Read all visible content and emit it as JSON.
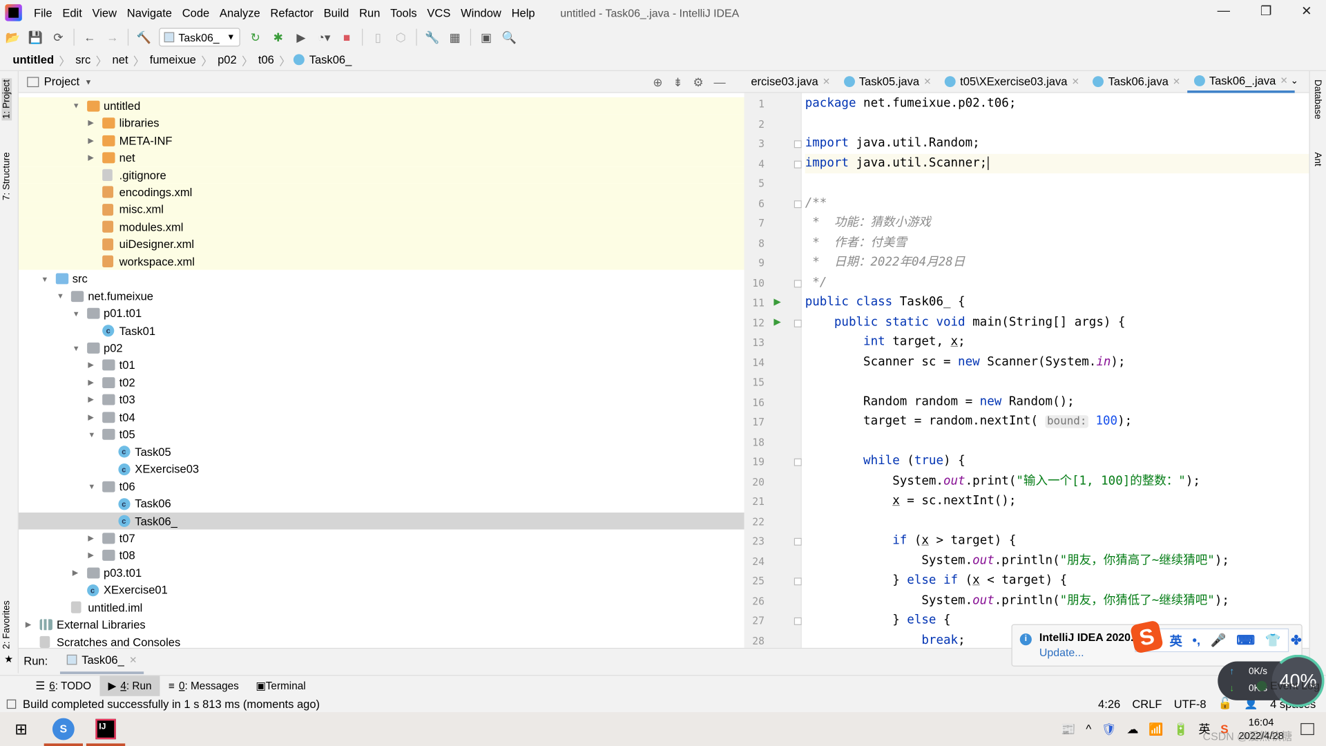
{
  "window": {
    "title": "untitled - Task06_.java - IntelliJ IDEA",
    "controls": [
      "—",
      "❐",
      "✕"
    ]
  },
  "menu": [
    "File",
    "Edit",
    "View",
    "Navigate",
    "Code",
    "Analyze",
    "Refactor",
    "Build",
    "Run",
    "Tools",
    "VCS",
    "Window",
    "Help"
  ],
  "toolbar": {
    "run_config": "Task06_"
  },
  "breadcrumb": [
    "untitled",
    "src",
    "net",
    "fumeixue",
    "p02",
    "t06",
    "Task06_"
  ],
  "left_tools": [
    "1: Project",
    "7: Structure",
    "2: Favorites"
  ],
  "right_tools": [
    "Database",
    "Ant"
  ],
  "project": {
    "title": "Project",
    "tree": [
      {
        "d": 3,
        "e": "open",
        "i": "folder orange",
        "l": "untitled",
        "x": 1
      },
      {
        "d": 4,
        "e": "closed",
        "i": "folder orange",
        "l": "libraries",
        "x": 1
      },
      {
        "d": 4,
        "e": "closed",
        "i": "folder orange",
        "l": "META-INF",
        "x": 1
      },
      {
        "d": 4,
        "e": "closed",
        "i": "folder orange",
        "l": "net",
        "x": 1
      },
      {
        "d": 4,
        "e": "",
        "i": "file",
        "l": ".gitignore",
        "x": 1
      },
      {
        "d": 4,
        "e": "",
        "i": "xml",
        "l": "encodings.xml",
        "x": 1
      },
      {
        "d": 4,
        "e": "",
        "i": "xml",
        "l": "misc.xml",
        "x": 1
      },
      {
        "d": 4,
        "e": "",
        "i": "xml",
        "l": "modules.xml",
        "x": 1
      },
      {
        "d": 4,
        "e": "",
        "i": "xml",
        "l": "uiDesigner.xml",
        "x": 1
      },
      {
        "d": 4,
        "e": "",
        "i": "xml",
        "l": "workspace.xml",
        "x": 1
      },
      {
        "d": 1,
        "e": "open",
        "i": "folder blue",
        "l": "src"
      },
      {
        "d": 2,
        "e": "open",
        "i": "folder",
        "l": "net.fumeixue"
      },
      {
        "d": 3,
        "e": "open",
        "i": "folder",
        "l": "p01.t01"
      },
      {
        "d": 4,
        "e": "",
        "i": "java",
        "l": "Task01"
      },
      {
        "d": 3,
        "e": "open",
        "i": "folder",
        "l": "p02"
      },
      {
        "d": 4,
        "e": "closed",
        "i": "folder",
        "l": "t01"
      },
      {
        "d": 4,
        "e": "closed",
        "i": "folder",
        "l": "t02"
      },
      {
        "d": 4,
        "e": "closed",
        "i": "folder",
        "l": "t03"
      },
      {
        "d": 4,
        "e": "closed",
        "i": "folder",
        "l": "t04"
      },
      {
        "d": 4,
        "e": "open",
        "i": "folder",
        "l": "t05"
      },
      {
        "d": 5,
        "e": "",
        "i": "java",
        "l": "Task05"
      },
      {
        "d": 5,
        "e": "",
        "i": "java",
        "l": "XExercise03"
      },
      {
        "d": 4,
        "e": "open",
        "i": "folder",
        "l": "t06"
      },
      {
        "d": 5,
        "e": "",
        "i": "java",
        "l": "Task06"
      },
      {
        "d": 5,
        "e": "",
        "i": "java",
        "l": "Task06_",
        "s": 1
      },
      {
        "d": 4,
        "e": "closed",
        "i": "folder",
        "l": "t07"
      },
      {
        "d": 4,
        "e": "closed",
        "i": "folder",
        "l": "t08"
      },
      {
        "d": 3,
        "e": "closed",
        "i": "folder",
        "l": "p03.t01"
      },
      {
        "d": 3,
        "e": "",
        "i": "java",
        "l": "XExercise01"
      },
      {
        "d": 2,
        "e": "",
        "i": "file",
        "l": "untitled.iml"
      },
      {
        "d": 0,
        "e": "closed",
        "i": "lib",
        "l": "External Libraries"
      },
      {
        "d": 0,
        "e": "",
        "i": "file",
        "l": "Scratches and Consoles"
      }
    ]
  },
  "tabs": [
    {
      "l": "ercise03.java"
    },
    {
      "l": "Task05.java"
    },
    {
      "l": "t05\\XExercise03.java"
    },
    {
      "l": "Task06.java"
    },
    {
      "l": "Task06_.java",
      "active": true
    }
  ],
  "code": [
    [
      [
        "package",
        "kw"
      ],
      [
        " net.fumeixue.p02.t06;",
        ""
      ]
    ],
    [],
    [
      [
        "import",
        "kw"
      ],
      [
        " java.util.Random;",
        ""
      ]
    ],
    [
      [
        "import",
        "kw"
      ],
      [
        " java.util.Scanner;",
        ""
      ],
      [
        "",
        "caret"
      ]
    ],
    [],
    [
      [
        "/**",
        "cm"
      ]
    ],
    [
      [
        " *  功能：猜数小游戏",
        "cm"
      ]
    ],
    [
      [
        " *  作者：付美雪",
        "cm"
      ]
    ],
    [
      [
        " *  日期：2022年04月28日",
        "cm"
      ]
    ],
    [
      [
        " */",
        "cm"
      ]
    ],
    [
      [
        "public class",
        "kw"
      ],
      [
        " Task06_ {",
        ""
      ]
    ],
    [
      [
        "    "
      ],
      [
        "public static void",
        "kw"
      ],
      [
        " main(String[] args) {",
        ""
      ]
    ],
    [
      [
        "        "
      ],
      [
        "int",
        "kw"
      ],
      [
        " target, ",
        ""
      ],
      [
        "x",
        "und"
      ],
      [
        ";",
        ""
      ]
    ],
    [
      [
        "        Scanner sc = ",
        ""
      ],
      [
        "new",
        "kw"
      ],
      [
        " Scanner(System.",
        ""
      ],
      [
        "in",
        "fld"
      ],
      [
        ");",
        ""
      ]
    ],
    [],
    [
      [
        "        Random random = ",
        ""
      ],
      [
        "new",
        "kw"
      ],
      [
        " Random();",
        ""
      ]
    ],
    [
      [
        "        target = random.nextInt( ",
        ""
      ],
      [
        "bound:",
        "hint"
      ],
      [
        " ",
        ""
      ],
      [
        "100",
        "num"
      ],
      [
        ");",
        ""
      ]
    ],
    [],
    [
      [
        "        "
      ],
      [
        "while",
        "kw"
      ],
      [
        " (",
        ""
      ],
      [
        "true",
        "kw"
      ],
      [
        ") {",
        ""
      ]
    ],
    [
      [
        "            System.",
        ""
      ],
      [
        "out",
        "fld"
      ],
      [
        ".print(",
        ""
      ],
      [
        "\"输入一个[1, 100]的整数：\"",
        "str"
      ],
      [
        ");",
        ""
      ]
    ],
    [
      [
        "            "
      ],
      [
        "x",
        "und"
      ],
      [
        " = sc.nextInt();",
        ""
      ]
    ],
    [],
    [
      [
        "            "
      ],
      [
        "if",
        "kw"
      ],
      [
        " (",
        ""
      ],
      [
        "x",
        "und"
      ],
      [
        " > target) {",
        ""
      ]
    ],
    [
      [
        "                System.",
        ""
      ],
      [
        "out",
        "fld"
      ],
      [
        ".println(",
        ""
      ],
      [
        "\"朋友，你猜高了~继续猜吧\"",
        "str"
      ],
      [
        ");",
        ""
      ]
    ],
    [
      [
        "            } ",
        ""
      ],
      [
        "else if",
        "kw"
      ],
      [
        " (",
        ""
      ],
      [
        "x",
        "und"
      ],
      [
        " < target) {",
        ""
      ]
    ],
    [
      [
        "                System.",
        ""
      ],
      [
        "out",
        "fld"
      ],
      [
        ".println(",
        ""
      ],
      [
        "\"朋友，你猜低了~继续猜吧\"",
        "str"
      ],
      [
        ");",
        ""
      ]
    ],
    [
      [
        "            } ",
        ""
      ],
      [
        "else",
        "kw"
      ],
      [
        " {",
        ""
      ]
    ],
    [
      [
        "                "
      ],
      [
        "break",
        "kw"
      ],
      [
        ";",
        ""
      ]
    ]
  ],
  "run_marks": [
    11,
    12
  ],
  "folds": [
    3,
    4,
    6,
    10,
    12,
    19,
    23,
    25,
    27
  ],
  "current_line": 4,
  "run": {
    "label": "Run:",
    "tab": "Task06_"
  },
  "bottom_tabs": [
    {
      "k": "6",
      "l": ": TODO"
    },
    {
      "k": "4",
      "l": ": Run",
      "active": true
    },
    {
      "k": "0",
      "l": ": Messages"
    },
    {
      "k": "",
      "l": "Terminal"
    }
  ],
  "status": {
    "message": "Build completed successfully in 1 s 813 ms (moments ago)",
    "position": "4:26",
    "line_sep": "CRLF",
    "encoding": "UTF-8",
    "indent": "4 spaces",
    "event_log": "Event Log"
  },
  "notification": {
    "title": "IntelliJ IDEA 2020.1",
    "link": "Update..."
  },
  "ime": {
    "logo": "S",
    "items": [
      "英",
      "•,",
      "🎤",
      "⌨",
      "👕",
      "✤"
    ]
  },
  "netmon": {
    "up": "0K/s",
    "down": "0K/s",
    "load": "40%"
  },
  "taskbar": {
    "time": "16:04",
    "date": "2022/4/28",
    "ime": "英",
    "watermark": "CSDN @爱熊软糖"
  }
}
